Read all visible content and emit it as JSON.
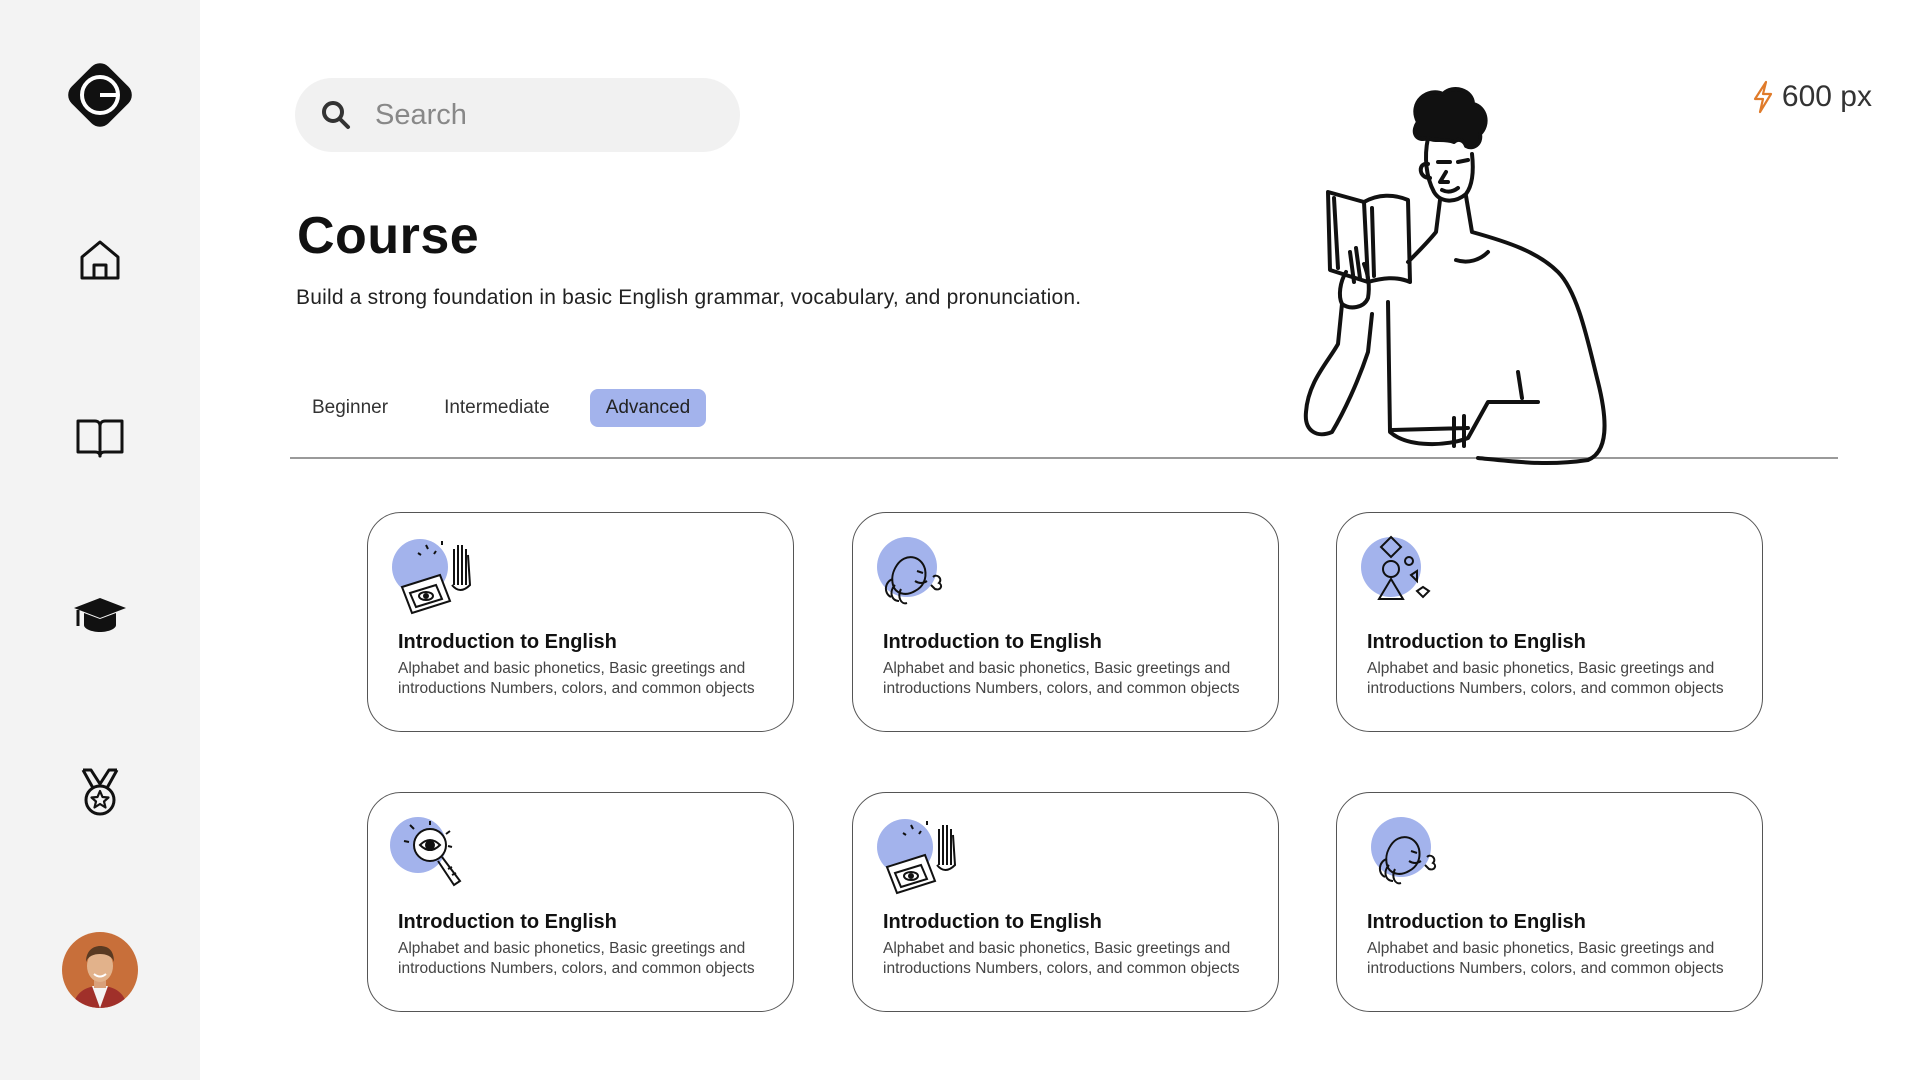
{
  "app": {
    "logo_letter": "G"
  },
  "sidebar": {
    "items": [
      {
        "name": "home",
        "icon": "home-icon"
      },
      {
        "name": "courses",
        "icon": "book-icon"
      },
      {
        "name": "learning",
        "icon": "graduation-cap-icon"
      },
      {
        "name": "achievements",
        "icon": "medal-icon"
      }
    ],
    "avatar": "user-avatar"
  },
  "search": {
    "placeholder": "Search",
    "icon": "search-icon"
  },
  "points": {
    "value": "600 px",
    "icon": "lightning-icon",
    "color": "#e07b2a"
  },
  "header": {
    "title": "Course",
    "subtitle": "Build a strong foundation in basic English grammar, vocabulary, and pronunciation."
  },
  "tabs": [
    {
      "label": "Beginner",
      "active": false
    },
    {
      "label": "Intermediate",
      "active": false
    },
    {
      "label": "Advanced",
      "active": true
    }
  ],
  "accent": "#a3b3ec",
  "cards": [
    {
      "title": "Introduction to English",
      "desc": "Alphabet and basic phonetics, Basic greetings and introductions Numbers, colors, and common objects",
      "illustration": "laptop-hand-illustration"
    },
    {
      "title": "Introduction to English",
      "desc": "Alphabet and basic phonetics, Basic greetings and introductions Numbers, colors, and common objects",
      "illustration": "speaking-head-illustration"
    },
    {
      "title": "Introduction to English",
      "desc": "Alphabet and basic phonetics, Basic greetings and introductions Numbers, colors, and common objects",
      "illustration": "shapes-figure-illustration"
    },
    {
      "title": "Introduction to English",
      "desc": "Alphabet and basic phonetics, Basic greetings and introductions Numbers, colors, and common objects",
      "illustration": "magnifier-eye-illustration"
    },
    {
      "title": "Introduction to English",
      "desc": "Alphabet and basic phonetics, Basic greetings and introductions Numbers, colors, and common objects",
      "illustration": "laptop-hand-illustration"
    },
    {
      "title": "Introduction to English",
      "desc": "Alphabet and basic phonetics, Basic greetings and introductions Numbers, colors, and common objects",
      "illustration": "speaking-head-illustration"
    }
  ]
}
